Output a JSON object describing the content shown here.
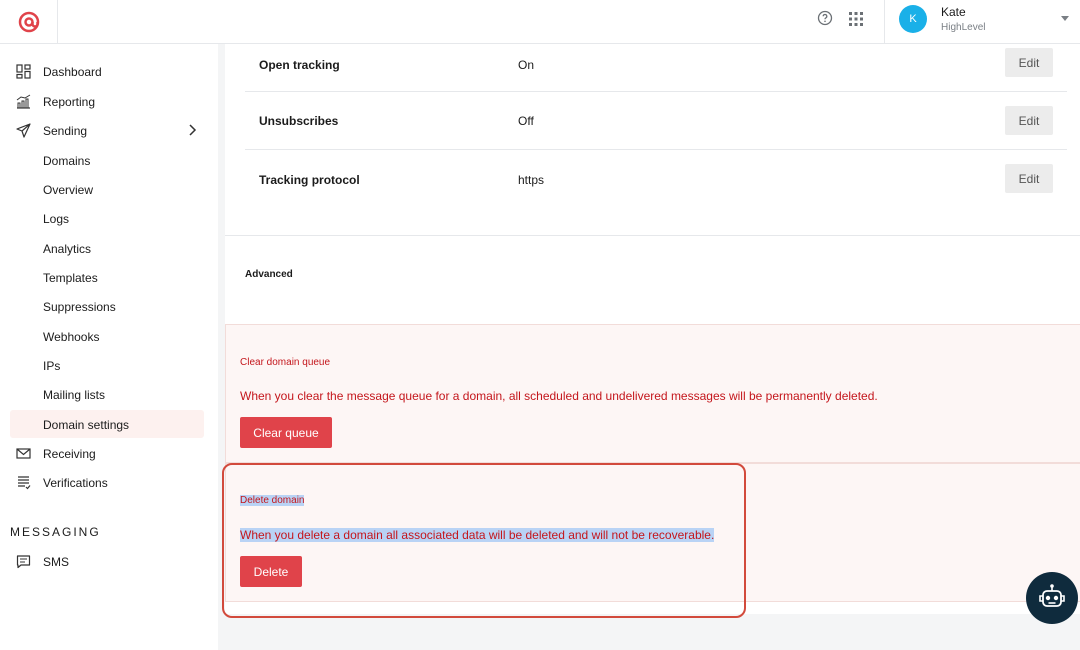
{
  "header": {
    "user_name": "Kate",
    "user_org": "HighLevel",
    "avatar_initial": "K"
  },
  "sidebar": {
    "items": [
      {
        "label": "Dashboard"
      },
      {
        "label": "Reporting"
      },
      {
        "label": "Sending"
      },
      {
        "label": "Domains"
      },
      {
        "label": "Overview"
      },
      {
        "label": "Logs"
      },
      {
        "label": "Analytics"
      },
      {
        "label": "Templates"
      },
      {
        "label": "Suppressions"
      },
      {
        "label": "Webhooks"
      },
      {
        "label": "IPs"
      },
      {
        "label": "Mailing lists"
      },
      {
        "label": "Domain settings"
      },
      {
        "label": "Receiving"
      },
      {
        "label": "Verifications"
      }
    ],
    "section_messaging": "MESSAGING",
    "sms": "SMS"
  },
  "settings": {
    "rows": [
      {
        "key": "Open tracking",
        "value": "On",
        "action": "Edit"
      },
      {
        "key": "Unsubscribes",
        "value": "Off",
        "action": "Edit"
      },
      {
        "key": "Tracking protocol",
        "value": "https",
        "action": "Edit"
      }
    ],
    "advanced_label": "Advanced"
  },
  "clear_queue": {
    "title": "Clear domain queue",
    "description": "When you clear the message queue for a domain, all scheduled and undelivered messages will be permanently deleted.",
    "button": "Clear queue"
  },
  "delete_domain": {
    "title": "Delete domain",
    "description": "When you delete a domain all associated data will be deleted and will not be recoverable.",
    "button": "Delete"
  },
  "colors": {
    "accent": "#e0434a",
    "danger_text": "#c4161c",
    "avatar": "#1ab0e8",
    "active_bg": "#fdf1ef"
  }
}
